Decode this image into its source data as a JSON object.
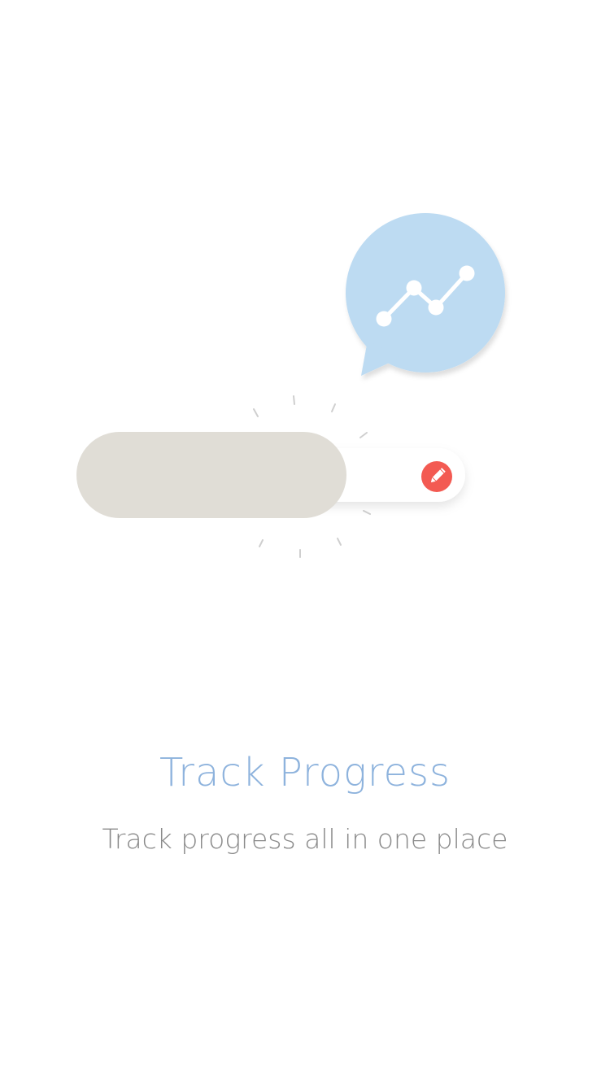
{
  "onboarding": {
    "title": "Track Progress",
    "subtitle": "Track progress all in one place"
  },
  "illustration": {
    "chart_bubble_icon": "line-chart-icon",
    "edit_icon": "pencil-icon",
    "toggle_on_color": "#e0ddd6",
    "bubble_color": "#bddbf2",
    "edit_color": "#f35a52",
    "title_color": "#8eb3dd",
    "subtitle_color": "#8a8a8a"
  }
}
